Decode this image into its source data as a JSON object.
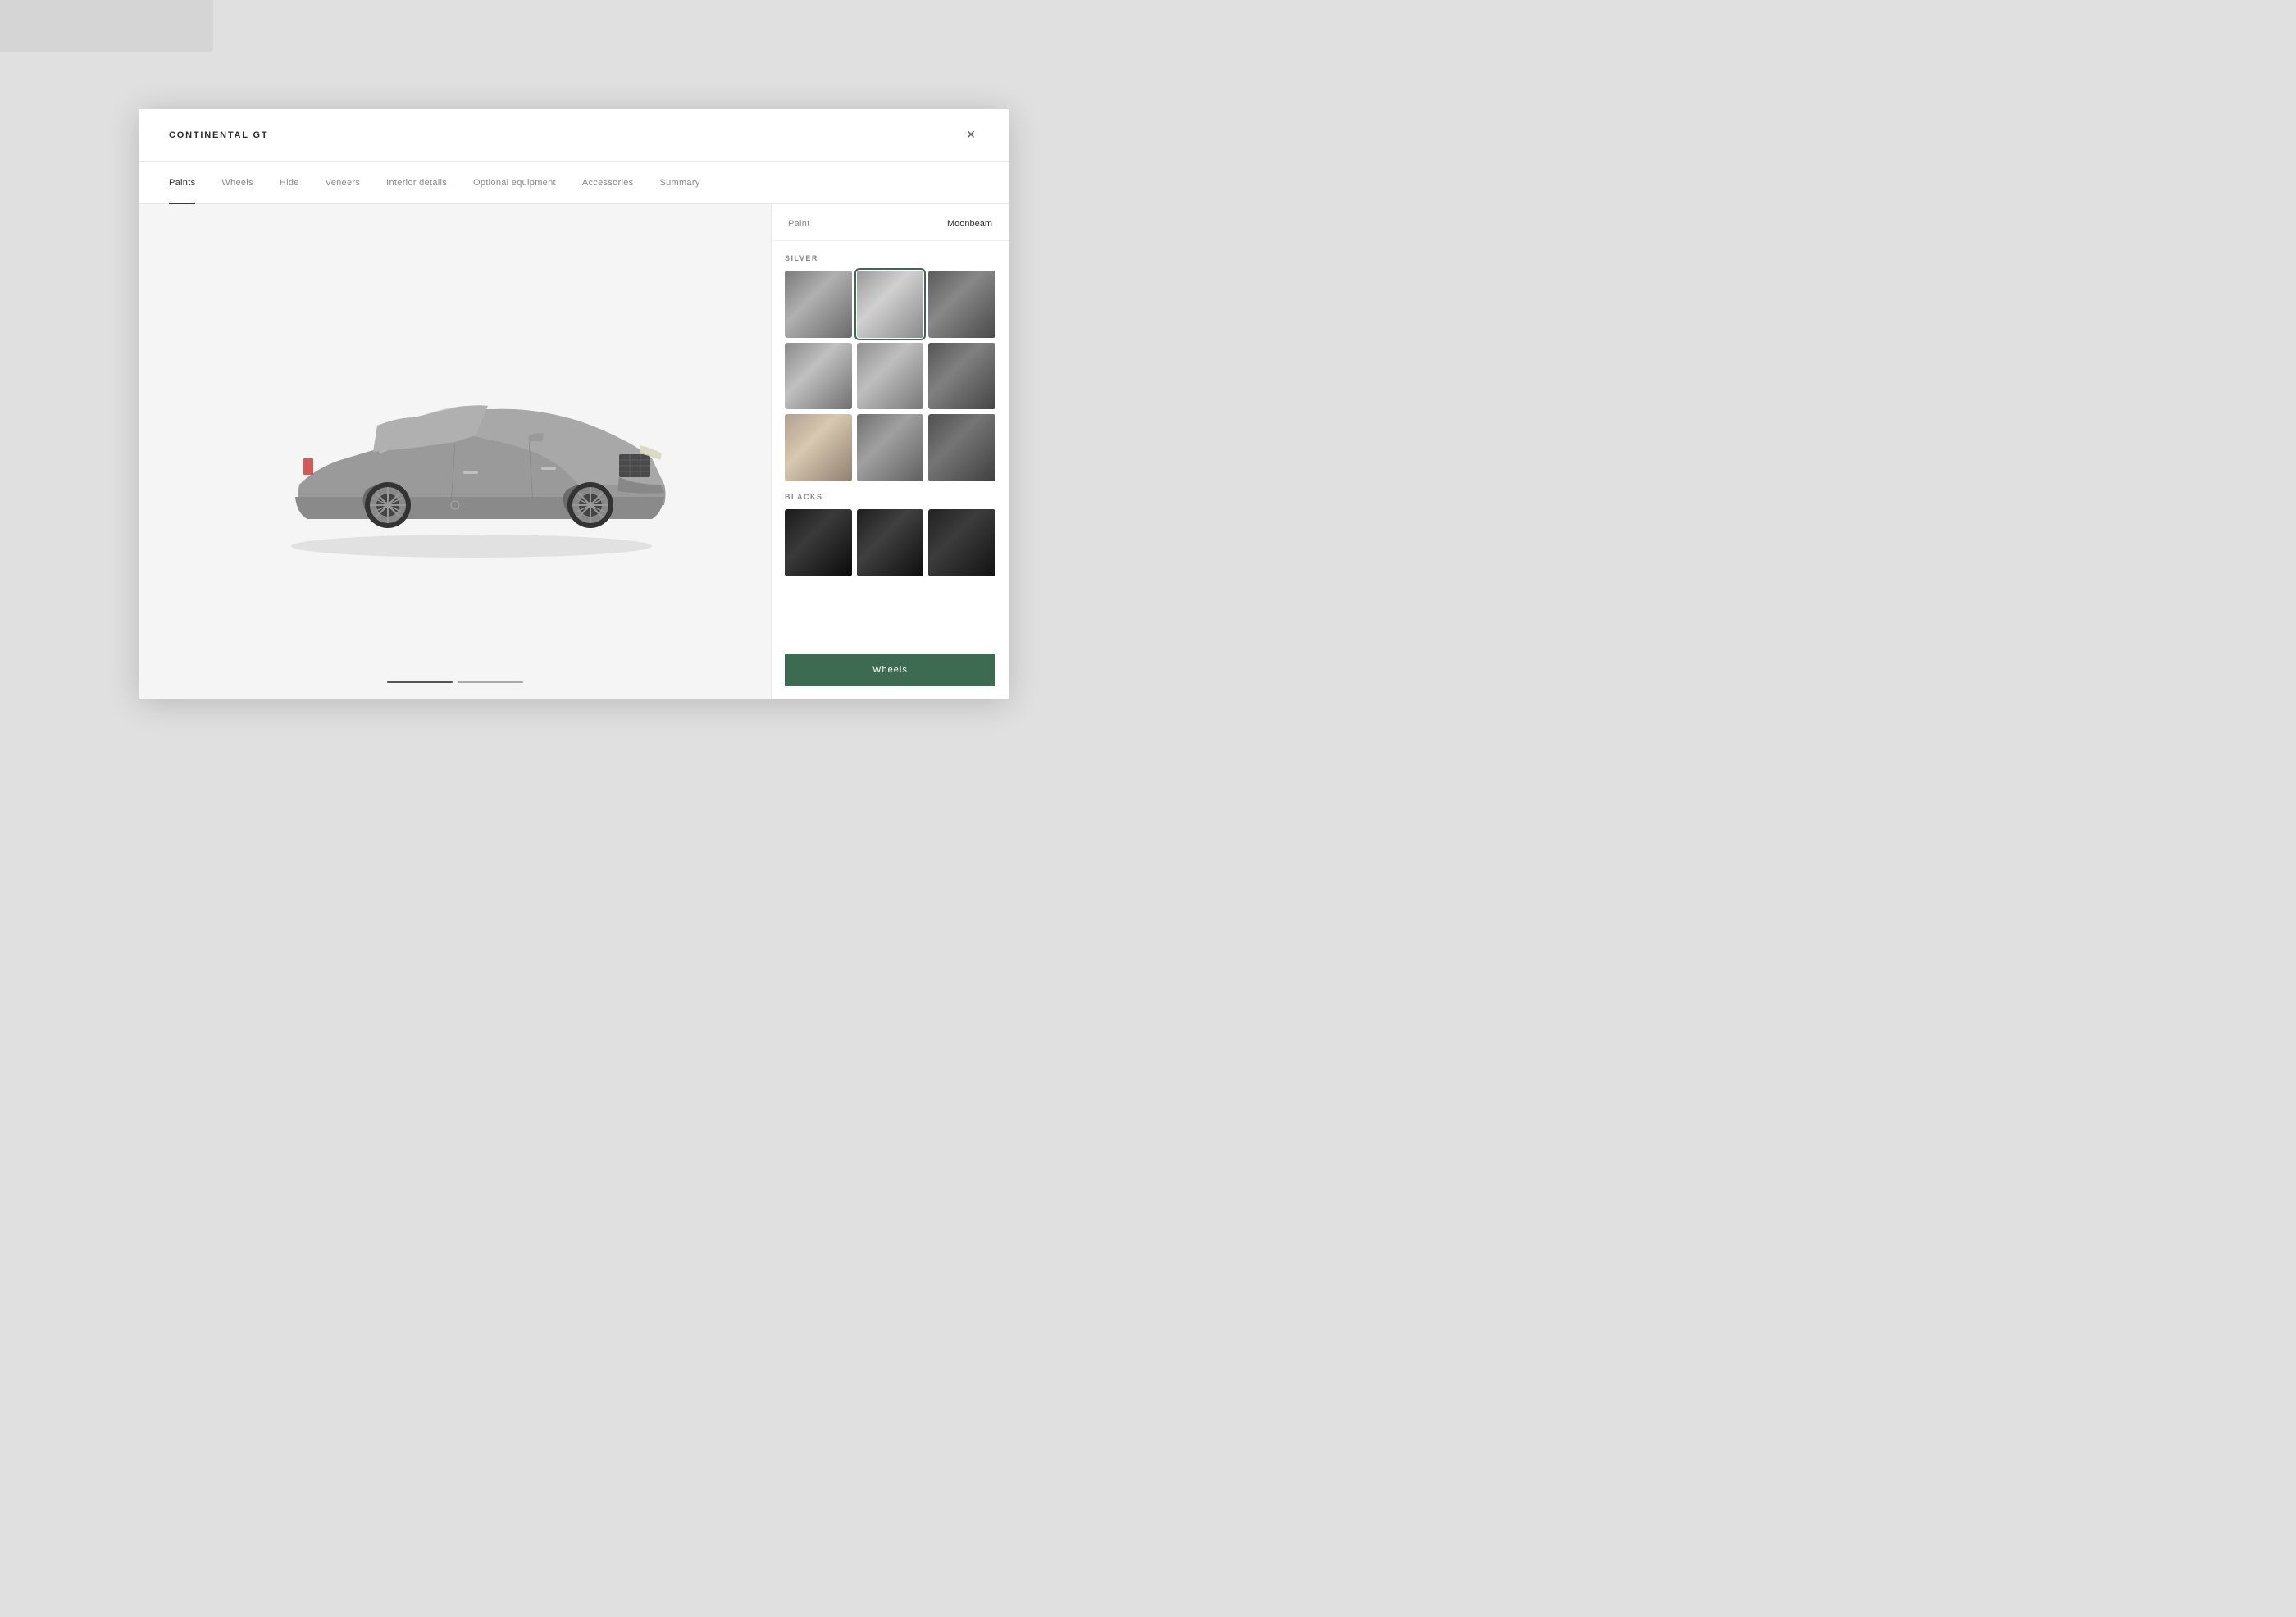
{
  "modal": {
    "title": "CONTINENTAL GT",
    "close_label": "×"
  },
  "nav": {
    "items": [
      {
        "id": "paints",
        "label": "Paints",
        "active": true
      },
      {
        "id": "wheels",
        "label": "Wheels",
        "active": false
      },
      {
        "id": "hide",
        "label": "Hide",
        "active": false
      },
      {
        "id": "veneers",
        "label": "Veneers",
        "active": false
      },
      {
        "id": "interior-details",
        "label": "Interior details",
        "active": false
      },
      {
        "id": "optional-equipment",
        "label": "Optional equipment",
        "active": false
      },
      {
        "id": "accessories",
        "label": "Accessories",
        "active": false
      },
      {
        "id": "summary",
        "label": "Summary",
        "active": false
      }
    ]
  },
  "paint_panel": {
    "label": "Paint",
    "value": "Moonbeam",
    "categories": [
      {
        "id": "silver",
        "label": "SILVER",
        "swatches": [
          {
            "id": 1,
            "selected": false
          },
          {
            "id": 2,
            "selected": true
          },
          {
            "id": 3,
            "selected": false
          },
          {
            "id": 4,
            "selected": false
          },
          {
            "id": 5,
            "selected": false
          },
          {
            "id": 6,
            "selected": false
          },
          {
            "id": 7,
            "selected": false
          },
          {
            "id": 8,
            "selected": false
          },
          {
            "id": 9,
            "selected": false
          }
        ]
      },
      {
        "id": "blacks",
        "label": "BLACKS",
        "swatches": [
          {
            "id": 1,
            "selected": false
          },
          {
            "id": 2,
            "selected": false
          },
          {
            "id": 3,
            "selected": false
          }
        ]
      }
    ]
  },
  "wheels_button": {
    "label": "Wheels"
  },
  "dots": [
    {
      "active": true
    },
    {
      "active": false
    }
  ]
}
